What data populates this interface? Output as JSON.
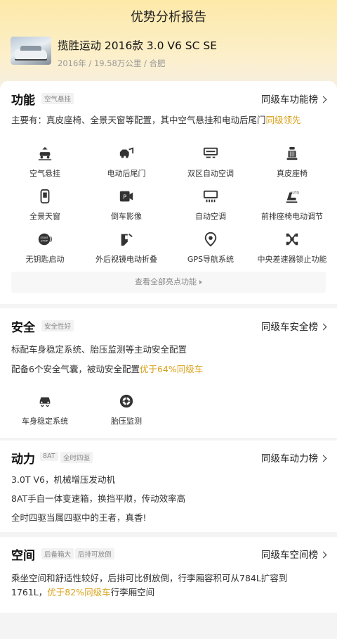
{
  "header": {
    "title": "优势分析报告",
    "car_name": "揽胜运动 2016款 3.0 V6 SC SE",
    "car_meta": "2016年 / 19.58万公里 / 合肥"
  },
  "function": {
    "title": "功能",
    "tag": "空气悬挂",
    "rank_label": "同级车功能榜",
    "desc_prefix": "主要有：真皮座椅、全景天窗等配置，其中空气悬挂和电动后尾门",
    "desc_highlight": "同级领先",
    "features": [
      {
        "label": "空气悬挂",
        "icon": "air-suspension-icon"
      },
      {
        "label": "电动后尾门",
        "icon": "power-tailgate-icon"
      },
      {
        "label": "双区自动空调",
        "icon": "dual-zone-ac-icon"
      },
      {
        "label": "真皮座椅",
        "icon": "leather-seat-icon"
      },
      {
        "label": "全景天窗",
        "icon": "panoramic-sunroof-icon"
      },
      {
        "label": "倒车影像",
        "icon": "reverse-camera-icon"
      },
      {
        "label": "自动空调",
        "icon": "auto-ac-icon"
      },
      {
        "label": "前排座椅电动调节",
        "icon": "power-seat-icon"
      },
      {
        "label": "无钥匙启动",
        "icon": "keyless-start-icon"
      },
      {
        "label": "外后视镜电动折叠",
        "icon": "mirror-fold-icon"
      },
      {
        "label": "GPS导航系统",
        "icon": "gps-nav-icon"
      },
      {
        "label": "中央差速器锁止功能",
        "icon": "diff-lock-icon"
      }
    ],
    "more_label": "查看全部亮点功能"
  },
  "safety": {
    "title": "安全",
    "tag": "安全性好",
    "rank_label": "同级车安全榜",
    "line1": "标配车身稳定系统、胎压监测等主动安全配置",
    "line2_prefix": "配备6个安全气囊，被动安全配置",
    "line2_highlight": "优于64%同级车",
    "features": [
      {
        "label": "车身稳定系统",
        "icon": "stability-control-icon"
      },
      {
        "label": "胎压监测",
        "icon": "tire-pressure-icon"
      }
    ]
  },
  "power": {
    "title": "动力",
    "tags": [
      "8AT",
      "全时四驱"
    ],
    "rank_label": "同级车动力榜",
    "lines": [
      "3.0T V6，机械增压发动机",
      "8AT手自一体变速箱，换挡平顺，传动效率高",
      "全时四驱当属四驱中的王者，真香!"
    ]
  },
  "space": {
    "title": "空间",
    "tags": [
      "后备箱大",
      "后排可放倒"
    ],
    "rank_label": "同级车空间榜",
    "line1": "乘坐空间和舒适性较好，后排可比例放倒，行李厢容积可从784L扩容到",
    "line2_prefix": "1761L，",
    "line2_highlight": "优于82%同级车",
    "line2_suffix": "行李厢空间"
  },
  "colors": {
    "accent": "#d9a21b",
    "header_bg": "#fde9a8"
  }
}
